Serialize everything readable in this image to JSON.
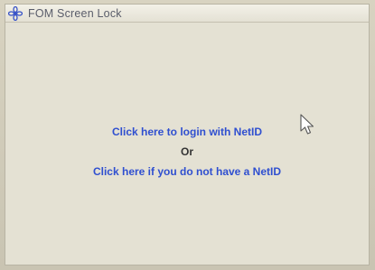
{
  "window": {
    "title": "FOM Screen Lock",
    "icon": "gear-flower-icon"
  },
  "main": {
    "login_link": "Click here to login with NetID",
    "or_text": "Or",
    "no_netid_link": "Click here if you do not have a NetID"
  },
  "colors": {
    "link": "#2f4fd0",
    "window_bg": "#e4e1d3",
    "title_text": "#5a5d6a"
  },
  "cursor": {
    "icon": "mouse-pointer-icon"
  }
}
